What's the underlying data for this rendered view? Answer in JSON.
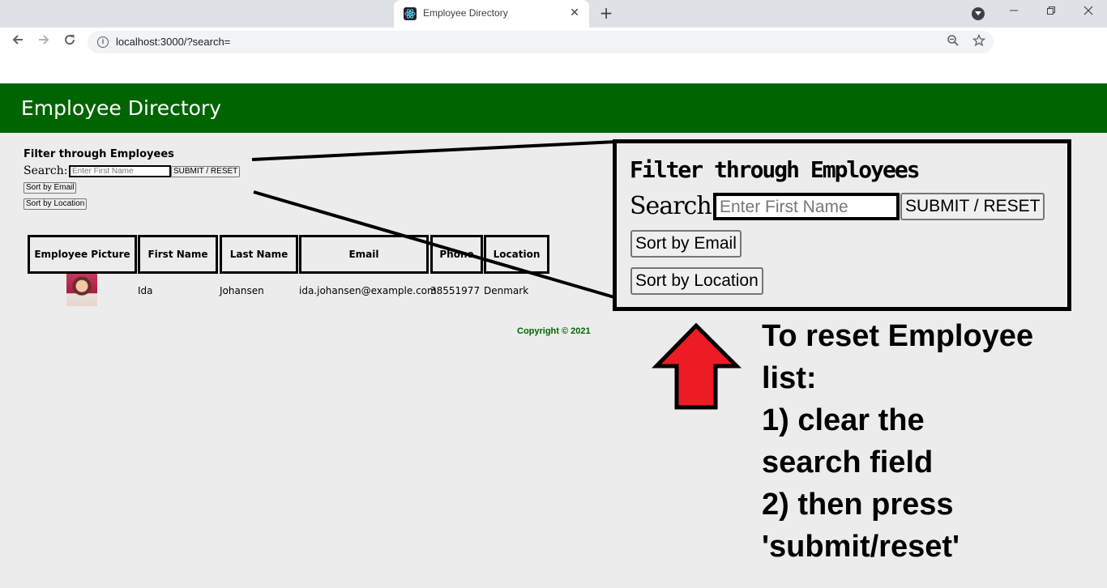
{
  "browser": {
    "tab_title": "Employee Directory",
    "url": "localhost:3000/?search=",
    "new_tab_symbol": "+",
    "close_symbol": "✕",
    "icons": [
      "react-icon",
      "info-icon",
      "zoom-icon",
      "star-icon",
      "back-icon",
      "forward-icon",
      "reload-icon"
    ]
  },
  "header": {
    "title": "Employee Directory",
    "background_color": "#006400"
  },
  "filter": {
    "title": "Filter through Employees",
    "search_label": "Search:",
    "search_placeholder": "Enter First Name",
    "search_value": "",
    "submit_label": "SUBMIT / RESET",
    "sort_email_label": "Sort by Email",
    "sort_location_label": "Sort by Location"
  },
  "table": {
    "columns": [
      "Employee Picture",
      "First Name",
      "Last Name",
      "Email",
      "Phone",
      "Location"
    ],
    "rows": [
      {
        "first_name": "Ida",
        "last_name": "Johansen",
        "email": "ida.johansen@example.com",
        "phone": "38551977",
        "location": "Denmark"
      }
    ]
  },
  "footer": {
    "copyright": "Copyright © 2021"
  },
  "annotation": {
    "zoom": {
      "title": "Filter through Employees",
      "search_label": "Search:",
      "search_placeholder": "Enter First Name",
      "submit_label": "SUBMIT / RESET",
      "sort_email_label": "Sort by Email",
      "sort_location_label": "Sort by Location"
    },
    "instructions": [
      "To reset Employee",
      "list:",
      "1) clear the",
      "search field",
      "2) then press",
      "'submit/reset'"
    ],
    "arrow_color": "#ed1c24"
  }
}
